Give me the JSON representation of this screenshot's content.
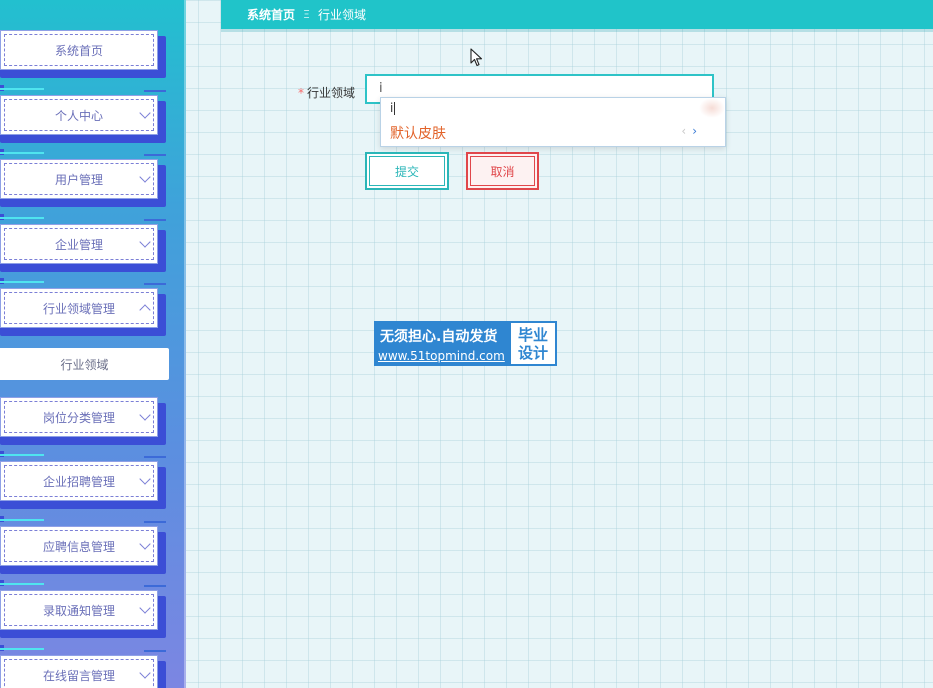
{
  "sidebar": {
    "items": [
      {
        "label": "系统首页",
        "chevron": "none"
      },
      {
        "label": "个人中心",
        "chevron": "down"
      },
      {
        "label": "用户管理",
        "chevron": "down"
      },
      {
        "label": "企业管理",
        "chevron": "down"
      },
      {
        "label": "行业领域管理",
        "chevron": "up"
      },
      {
        "label": "岗位分类管理",
        "chevron": "down"
      },
      {
        "label": "企业招聘管理",
        "chevron": "down"
      },
      {
        "label": "应聘信息管理",
        "chevron": "down"
      },
      {
        "label": "录取通知管理",
        "chevron": "down"
      },
      {
        "label": "在线留言管理",
        "chevron": "down"
      }
    ],
    "active_sub": {
      "label": "行业领域"
    }
  },
  "breadcrumb": {
    "home": "系统首页",
    "separator": "Ξ",
    "current": "行业领域"
  },
  "form": {
    "field_label": "行业领域",
    "required_mark": "*",
    "input_value": "i",
    "submit_label": "提交",
    "cancel_label": "取消"
  },
  "ime": {
    "composition": "i",
    "candidate": "默认皮肤",
    "prev": "‹",
    "next": "›"
  },
  "ad": {
    "line1": "无须担心.自动发货",
    "line2": "www.51topmind.com",
    "badge_line1": "毕业",
    "badge_line2": "设计"
  },
  "colors": {
    "accent": "#20c4c9",
    "cancel": "#e0474b",
    "candidate": "#e2632a"
  }
}
